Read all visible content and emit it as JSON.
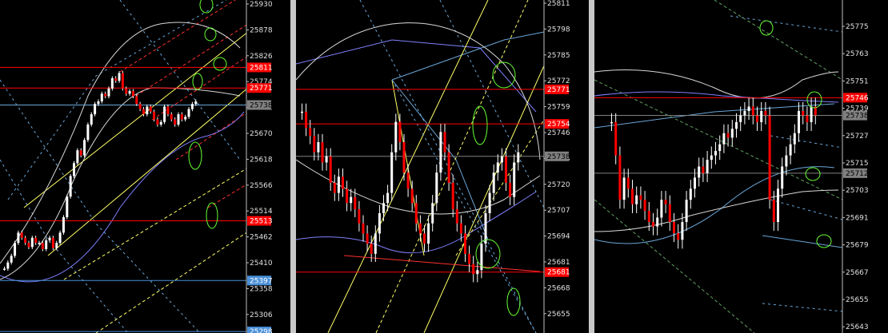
{
  "window": {
    "separator_color": "#c0c0c0",
    "background": "#000000"
  },
  "chart_data": [
    {
      "type": "candlestick",
      "panel": "left",
      "y_axis_ticks": [
        "25930",
        "25878",
        "25826",
        "25774",
        "25722",
        "25670",
        "25618",
        "25566",
        "25514",
        "25462",
        "25410",
        "25358",
        "25306"
      ],
      "ylim": [
        25295,
        25942
      ],
      "price_labels": [
        {
          "text": "25811",
          "value": 25811,
          "color": "#ff0000"
        },
        {
          "text": "25771",
          "value": 25771,
          "color": "#ff0000"
        },
        {
          "text": "25738",
          "value": 25738,
          "color": "#808080"
        },
        {
          "text": "25513",
          "value": 25513,
          "color": "#ff0000"
        },
        {
          "text": "25397",
          "value": 25397,
          "color": "#4a90d9"
        },
        {
          "text": "25298",
          "value": 25298,
          "color": "#4a90d9"
        }
      ],
      "horizontal_lines": [
        {
          "value": 25811,
          "color": "#ff0000"
        },
        {
          "value": 25771,
          "color": "#ff0000"
        },
        {
          "value": 25738,
          "color": "#6aa6d8"
        },
        {
          "value": 25513,
          "color": "#ff0000"
        },
        {
          "value": 25397,
          "color": "#4a90d9"
        },
        {
          "value": 25298,
          "color": "#4a90d9"
        }
      ],
      "closes": [
        25420,
        25432,
        25445,
        25470,
        25490,
        25480,
        25470,
        25462,
        25480,
        25470,
        25470,
        25458,
        25475,
        25480,
        25460,
        25470,
        25490,
        25520,
        25560,
        25600,
        25625,
        25650,
        25640,
        25670,
        25700,
        25720,
        25740,
        25745,
        25760,
        25755,
        25770,
        25790,
        25785,
        25800,
        25770,
        25760,
        25765,
        25755,
        25740,
        25730,
        25720,
        25735,
        25725,
        25710,
        25700,
        25705,
        25735,
        25720,
        25710,
        25700,
        25720,
        25710,
        25715,
        25730,
        25740,
        25745
      ]
    },
    {
      "type": "candlestick",
      "panel": "middle",
      "y_axis_ticks": [
        "25811",
        "25798",
        "25785",
        "25772",
        "25759",
        "25746",
        "25733",
        "25720",
        "25707",
        "25694",
        "25681",
        "25668",
        "25655"
      ],
      "ylim": [
        25651,
        25815
      ],
      "price_labels": [
        {
          "text": "25771",
          "value": 25771,
          "color": "#ff0000"
        },
        {
          "text": "25754",
          "value": 25754,
          "color": "#ff0000"
        },
        {
          "text": "25738",
          "value": 25738,
          "color": "#808080"
        },
        {
          "text": "25681",
          "value": 25681,
          "color": "#ff0000"
        }
      ],
      "horizontal_lines": [
        {
          "value": 25771,
          "color": "#ff0000"
        },
        {
          "value": 25754,
          "color": "#ff0000"
        },
        {
          "value": 25738,
          "color": "#808080"
        },
        {
          "value": 25681,
          "color": "#ff0000"
        }
      ],
      "closes": [
        25760,
        25752,
        25748,
        25740,
        25745,
        25735,
        25738,
        25725,
        25720,
        25728,
        25722,
        25715,
        25718,
        25712,
        25705,
        25700,
        25695,
        25690,
        25700,
        25710,
        25715,
        25720,
        25740,
        25755,
        25745,
        25730,
        25722,
        25715,
        25705,
        25700,
        25695,
        25705,
        25715,
        25730,
        25750,
        25740,
        25725,
        25712,
        25705,
        25700,
        25690,
        25685,
        25680,
        25682,
        25695,
        25710,
        25720,
        25730,
        25735,
        25738,
        25725,
        25718,
        25735,
        25740
      ]
    },
    {
      "type": "candlestick",
      "panel": "right",
      "y_axis_ticks": [
        "25775",
        "25763",
        "25751",
        "25739",
        "25727",
        "25715",
        "25703",
        "25691",
        "25679",
        "25667",
        "25655",
        "25643"
      ],
      "ylim": [
        25640,
        25790
      ],
      "price_labels": [
        {
          "text": "25746",
          "value": 25746,
          "color": "#ff0000"
        },
        {
          "text": "25738",
          "value": 25738,
          "color": "#808080"
        },
        {
          "text": "25712",
          "value": 25712,
          "color": "#808080"
        }
      ],
      "horizontal_lines": [
        {
          "value": 25746,
          "color": "#ff0000"
        },
        {
          "value": 25738,
          "color": "#808080"
        },
        {
          "value": 25712,
          "color": "#808080"
        }
      ],
      "closes": [
        25735,
        25720,
        25700,
        25710,
        25705,
        25698,
        25702,
        25700,
        25695,
        25690,
        25688,
        25692,
        25700,
        25698,
        25690,
        25685,
        25682,
        25690,
        25700,
        25705,
        25710,
        25715,
        25712,
        25718,
        25720,
        25722,
        25725,
        25730,
        25728,
        25732,
        25735,
        25738,
        25740,
        25742,
        25738,
        25735,
        25740,
        25738,
        25700,
        25690,
        25705,
        25715,
        25720,
        25725,
        25730,
        25740,
        25738,
        25735,
        25742,
        25738
      ]
    }
  ]
}
